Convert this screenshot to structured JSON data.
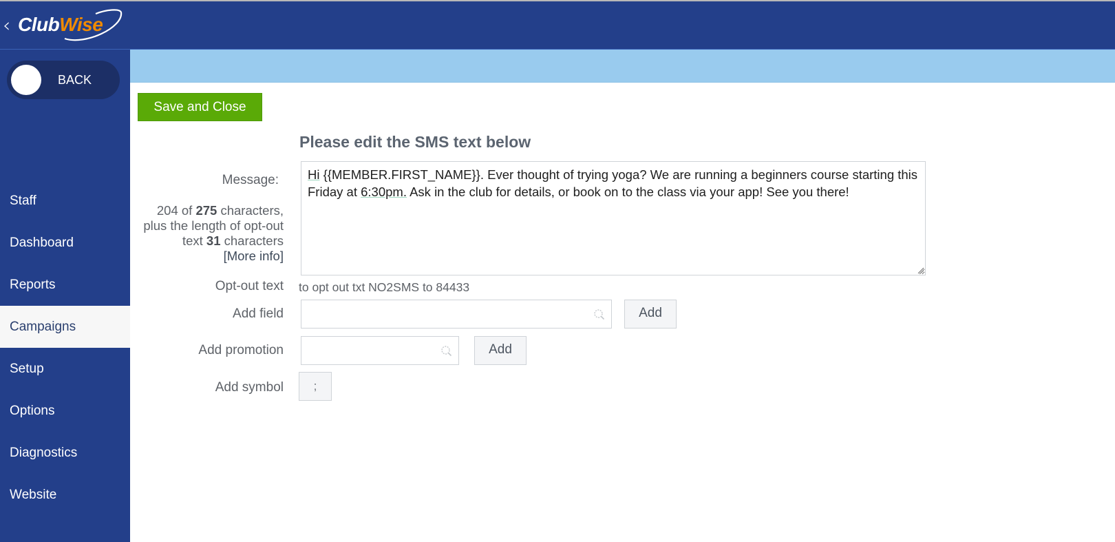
{
  "app": {
    "brand_part1": "Club",
    "brand_part2": "Wise",
    "colors": {
      "header_bg": "#233f8a",
      "subbar_bg": "#99cbee",
      "save_green": "#5aaa07",
      "brand_orange": "#f08a00"
    }
  },
  "sidebar": {
    "back_label": "BACK",
    "items": [
      {
        "label": "Staff",
        "active": false
      },
      {
        "label": "Dashboard",
        "active": false
      },
      {
        "label": "Reports",
        "active": false
      },
      {
        "label": "Campaigns",
        "active": true
      },
      {
        "label": "Setup",
        "active": false
      },
      {
        "label": "Options",
        "active": false
      },
      {
        "label": "Diagnostics",
        "active": false
      },
      {
        "label": "Website",
        "active": false
      }
    ]
  },
  "toolbar": {
    "save_close_label": "Save and Close"
  },
  "form": {
    "heading": "Please edit the SMS text below",
    "message_label": "Message:",
    "message": {
      "part1": "Hi",
      "part2": " {{MEMBER.FIRST_NAME}}. Ever thought of trying yoga? We are running a beginners course starting this Friday at ",
      "part3": "6:30pm.",
      "part4": " Ask in the club for details, or book on to the class via your app! See you there!"
    },
    "char_count": {
      "used": "204",
      "of_text": " of ",
      "max": "275",
      "after_max": " characters, plus the length of opt-out text ",
      "optout_len": "31",
      "after_optout": " characters",
      "more_info": "[More info]"
    },
    "optout_label": "Opt-out text",
    "optout_value": "to opt out txt NO2SMS to 84433",
    "add_field_label": "Add field",
    "add_field_value": "",
    "add_field_button": "Add",
    "add_promotion_label": "Add promotion",
    "add_promotion_value": "",
    "add_promotion_button": "Add",
    "add_symbol_label": "Add symbol",
    "symbol_button": ";"
  }
}
